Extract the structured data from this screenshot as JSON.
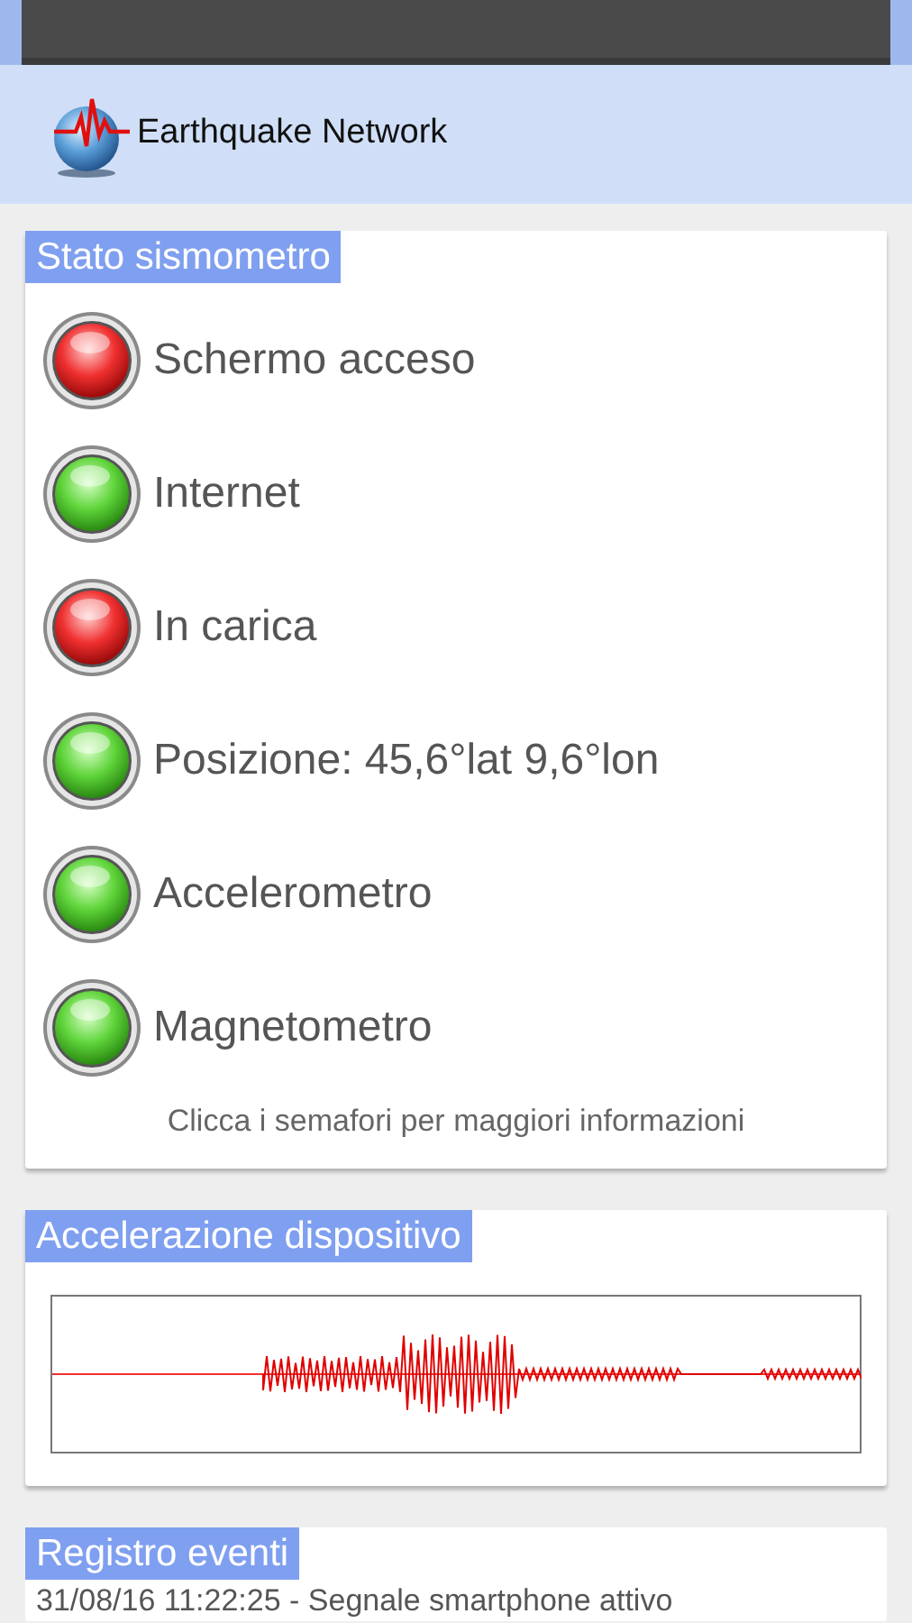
{
  "app_bar": {
    "title": "Earthquake Network"
  },
  "status_card": {
    "title": "Stato sismometro",
    "lights": [
      {
        "label": "Schermo acceso",
        "ok": false
      },
      {
        "label": "Internet",
        "ok": true
      },
      {
        "label": "In carica",
        "ok": false
      },
      {
        "label": "Posizione: 45,6°lat 9,6°lon",
        "ok": true
      },
      {
        "label": "Accelerometro",
        "ok": true
      },
      {
        "label": "Magnetometro",
        "ok": true
      }
    ],
    "hint": "Clicca i semafori per maggiori informazioni"
  },
  "acceleration_card": {
    "title": "Accelerazione dispositivo"
  },
  "log_card": {
    "title": "Registro eventi",
    "entries": [
      "31/08/16 11:22:25 - Segnale smartphone attivo"
    ]
  }
}
